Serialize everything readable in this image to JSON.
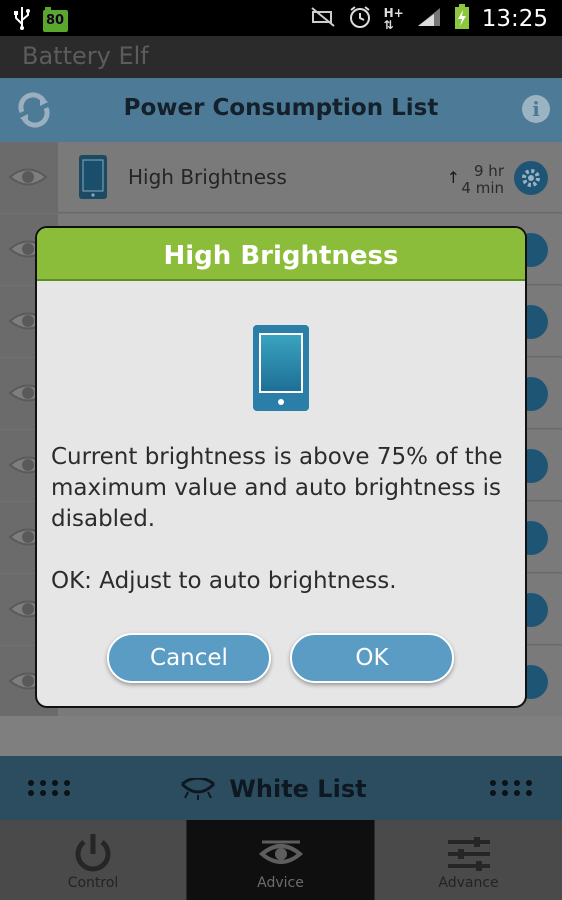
{
  "status_bar": {
    "time": "13:25",
    "battery_level": "80"
  },
  "app": {
    "title": "Battery Elf"
  },
  "header": {
    "title": "Power Consumption List"
  },
  "list": {
    "items": [
      {
        "name": "High Brightness",
        "time_line1": "9 hr",
        "time_line2": "4 min"
      }
    ]
  },
  "white_list": {
    "label": "White List"
  },
  "bottom_nav": {
    "tabs": [
      {
        "label": "Control",
        "icon": "power-icon"
      },
      {
        "label": "Advice",
        "icon": "eye-icon"
      },
      {
        "label": "Advance",
        "icon": "sliders-icon"
      }
    ],
    "active": "Advice"
  },
  "dialog": {
    "title": "High Brightness",
    "message": "Current brightness is above 75% of the maximum value and auto brightness is disabled.",
    "hint": "OK: Adjust to auto brightness.",
    "cancel_label": "Cancel",
    "ok_label": "OK",
    "icon": "phone-icon"
  },
  "colors": {
    "dialog_title_bg": "#8cbd3a",
    "button_bg": "#5b9cc4",
    "header_bg": "#4d7a96"
  }
}
